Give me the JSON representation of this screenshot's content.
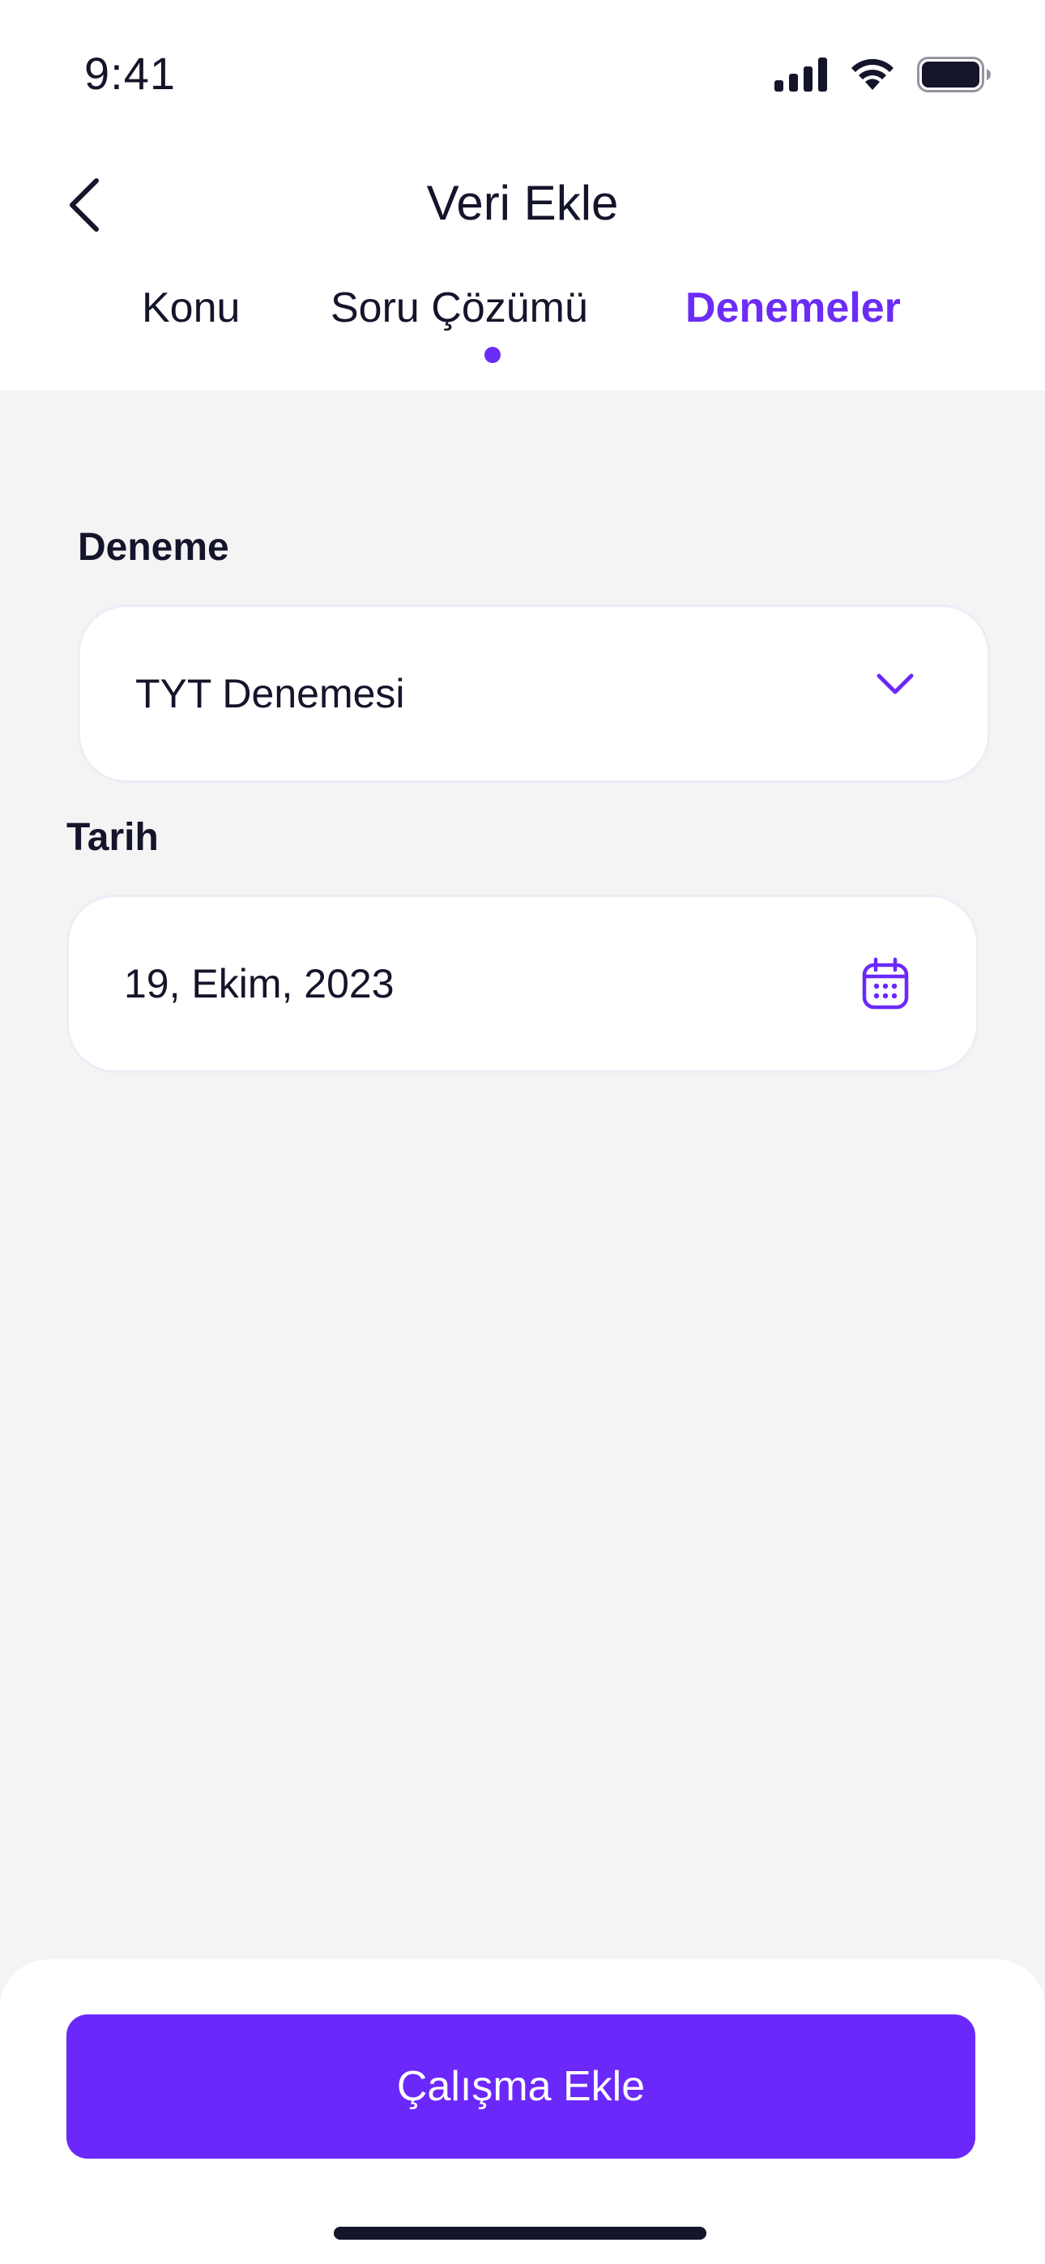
{
  "status_bar": {
    "time": "9:41",
    "icons": [
      "signal-icon",
      "wifi-icon",
      "battery-icon"
    ]
  },
  "header": {
    "title": "Veri Ekle",
    "back_icon": "chevron-left-icon"
  },
  "tabs": [
    {
      "label": "Konu",
      "active": false
    },
    {
      "label": "Soru Çözümü",
      "active": false
    },
    {
      "label": "Denemeler",
      "active": true
    }
  ],
  "form": {
    "deneme": {
      "label": "Deneme",
      "value": "TYT Denemesi",
      "icon": "chevron-down-icon"
    },
    "tarih": {
      "label": "Tarih",
      "value": "19, Ekim, 2023",
      "icon": "calendar-icon"
    }
  },
  "footer": {
    "button_label": "Çalışma Ekle"
  },
  "colors": {
    "accent": "#6b28fa",
    "text": "#14142b",
    "background": "#f4f4f5",
    "card": "#ffffff"
  }
}
